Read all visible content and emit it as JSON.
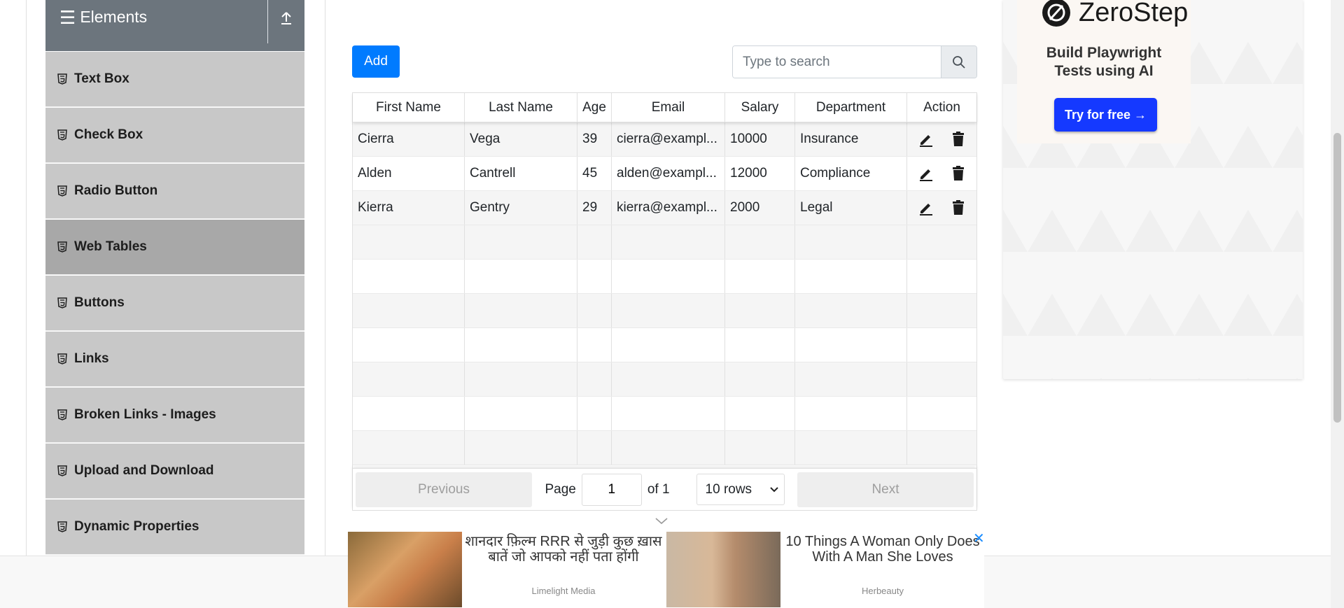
{
  "sidebar": {
    "group_title": "Elements",
    "items": [
      {
        "label": "Text Box",
        "active": false
      },
      {
        "label": "Check Box",
        "active": false
      },
      {
        "label": "Radio Button",
        "active": false
      },
      {
        "label": "Web Tables",
        "active": true
      },
      {
        "label": "Buttons",
        "active": false
      },
      {
        "label": "Links",
        "active": false
      },
      {
        "label": "Broken Links - Images",
        "active": false
      },
      {
        "label": "Upload and Download",
        "active": false
      },
      {
        "label": "Dynamic Properties",
        "active": false
      }
    ]
  },
  "toolbar": {
    "add_label": "Add",
    "search_placeholder": "Type to search"
  },
  "table": {
    "headers": [
      "First Name",
      "Last Name",
      "Age",
      "Email",
      "Salary",
      "Department",
      "Action"
    ],
    "rows": [
      [
        "Cierra",
        "Vega",
        "39",
        "cierra@exampl...",
        "10000",
        "Insurance"
      ],
      [
        "Alden",
        "Cantrell",
        "45",
        "alden@exampl...",
        "12000",
        "Compliance"
      ],
      [
        "Kierra",
        "Gentry",
        "29",
        "kierra@exampl...",
        "2000",
        "Legal"
      ]
    ],
    "empty_rows": 7
  },
  "pagination": {
    "previous_label": "Previous",
    "page_label": "Page",
    "page_value": "1",
    "of_label": "of 1",
    "rows_select": "10 rows",
    "next_label": "Next"
  },
  "side_ad": {
    "brand": "ZeroStep",
    "tagline_line1": "Build Playwright",
    "tagline_line2": "Tests using AI",
    "cta": "Try for free →"
  },
  "bottom_ad": {
    "item1_text": "शानदार फ़िल्म RRR से जुड़ी कुछ ख़ास बातें जो आपको नहीं पता होंगी",
    "item1_source": "Limelight Media",
    "item2_text": "10 Things A Woman Only Does With A Man She Loves",
    "item2_source": "Herbeauty",
    "close_glyph": "✕"
  },
  "colors": {
    "primary": "#007bff",
    "sidebar_header": "#6c757d",
    "menu_item": "#c8c8c8",
    "menu_item_active": "#a8a8a8",
    "ad_cta": "#1539ff"
  }
}
